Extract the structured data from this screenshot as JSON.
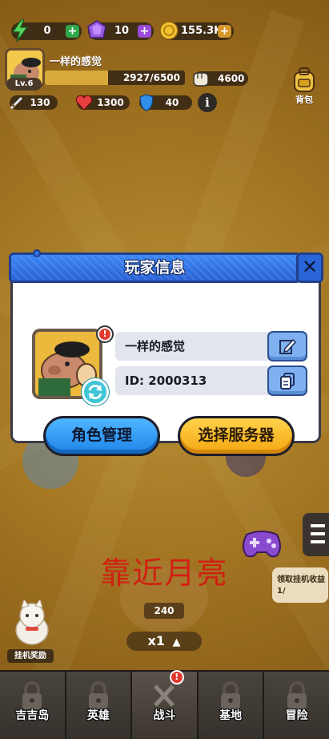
{
  "resources": {
    "energy": {
      "value": "0",
      "icon": "lightning-icon"
    },
    "gems": {
      "value": "10",
      "icon": "gem-icon"
    },
    "coins": {
      "value": "155.3K",
      "icon": "coin-icon"
    }
  },
  "player": {
    "name": "一样的感觉",
    "level": "Lv.6",
    "xp_text": "2927/6500",
    "xp_fraction": 0.45,
    "power": "4600",
    "bag_label": "背包"
  },
  "stats": {
    "attack": "130",
    "health": "1300",
    "defense": "40",
    "info_glyph": "i"
  },
  "dialog": {
    "title": "玩家信息",
    "close_glyph": "✕",
    "nickname": "一样的感觉",
    "player_id": "ID: 2000313",
    "notif_glyph": "!",
    "role_button": "角色管理",
    "server_button": "选择服务器"
  },
  "scene": {
    "watermark": "靠近月亮",
    "reward_value": "240",
    "speed_label": "x1",
    "speed_arrow": "▲",
    "idle_label": "挂机奖励",
    "side_card": "领取挂机收益",
    "side_card_sub": "1/"
  },
  "nav": {
    "tabs": [
      "吉吉岛",
      "英雄",
      "战斗",
      "基地",
      "冒险"
    ],
    "active_index": 2,
    "battle_badge": "!"
  },
  "colors": {
    "dialog_header": "#2f6fe0",
    "blue_button": "#1f84e8",
    "yellow_button": "#f4a712",
    "watermark": "#d21f12"
  }
}
